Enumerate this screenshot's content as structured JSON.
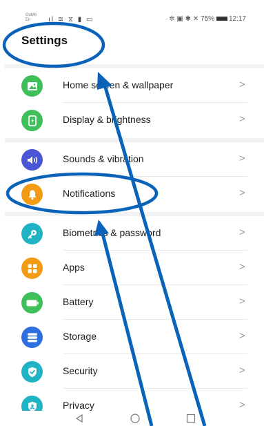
{
  "status_bar": {
    "carrier_line1": "GoMo",
    "carrier_line2": "Eir",
    "left_icons": "ıl ≋ ⧖ ▮ ▭",
    "right_icons": "✲ ▣ ✱ ✕",
    "battery_percent": "75%",
    "time": "12:17"
  },
  "page_title": "Settings",
  "groups": [
    {
      "items": [
        {
          "label": "Home screen & wallpaper",
          "icon": "image-icon",
          "color": "#3fbf5a"
        },
        {
          "label": "Display & brightness",
          "icon": "phone-display-icon",
          "color": "#3fbf5a"
        }
      ]
    },
    {
      "items": [
        {
          "label": "Sounds & vibration",
          "icon": "speaker-icon",
          "color": "#4a56d6"
        },
        {
          "label": "Notifications",
          "icon": "bell-icon",
          "color": "#f29b13"
        }
      ]
    },
    {
      "items": [
        {
          "label": "Biometrics & password",
          "icon": "key-icon",
          "color": "#1fb3c4"
        },
        {
          "label": "Apps",
          "icon": "apps-grid-icon",
          "color": "#f29b13"
        },
        {
          "label": "Battery",
          "icon": "battery-icon",
          "color": "#3fbf5a"
        },
        {
          "label": "Storage",
          "icon": "storage-icon",
          "color": "#2e6fe0"
        },
        {
          "label": "Security",
          "icon": "shield-check-icon",
          "color": "#1fb3c4"
        },
        {
          "label": "Privacy",
          "icon": "privacy-icon",
          "color": "#1fb3c4"
        }
      ]
    }
  ],
  "chevron": ">",
  "nav_bar": {
    "back": "back-triangle-icon",
    "home": "home-circle-icon",
    "recents": "recents-square-icon"
  },
  "annotation_color": "#0a63b8"
}
